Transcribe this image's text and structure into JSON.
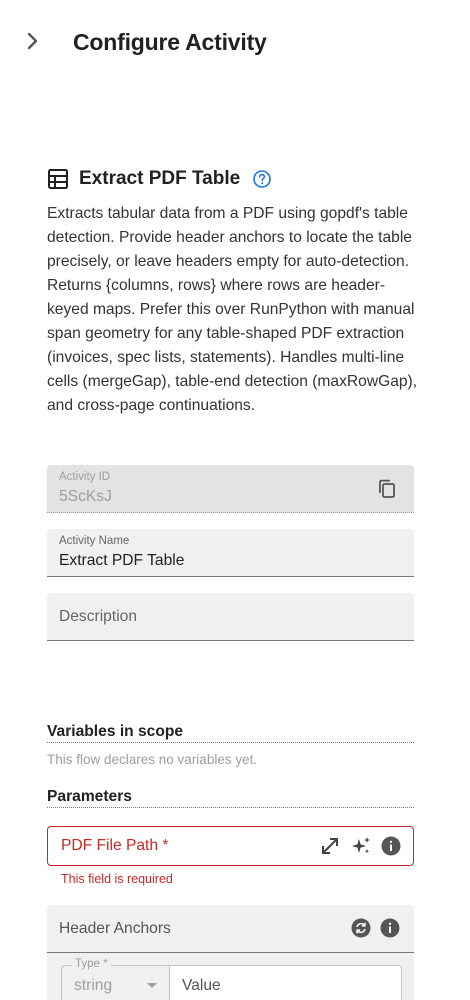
{
  "header": {
    "title": "Configure Activity"
  },
  "activity": {
    "title": "Extract PDF Table",
    "description": "Extracts tabular data from a PDF using gopdf's table detection. Provide header anchors to locate the table precisely, or leave headers empty for auto-detection. Returns {columns, rows} where rows are header-keyed maps. Prefer this over RunPython with manual span geometry for any table-shaped PDF extraction (invoices, spec lists, statements). Handles multi-line cells (mergeGap), table-end detection (maxRowGap), and cross-page continuations."
  },
  "fields": {
    "activity_id": {
      "label": "Activity ID",
      "value": "5ScKsJ"
    },
    "activity_name": {
      "label": "Activity Name",
      "value": "Extract PDF Table"
    },
    "description": {
      "placeholder": "Description"
    }
  },
  "variables": {
    "title": "Variables in scope",
    "empty_note": "This flow declares no variables yet."
  },
  "parameters": {
    "title": "Parameters",
    "pdf_file_path": {
      "label": "PDF File Path *",
      "error": "This field is required"
    },
    "header_anchors": {
      "title": "Header Anchors",
      "type_label": "Type *",
      "type_value": "string",
      "value_placeholder": "Value"
    }
  },
  "icons": {
    "collapse": "chevron-right-icon",
    "table": "table-icon",
    "help": "help-circle-icon",
    "copy": "copy-icon",
    "expand": "expand-diagonal-icon",
    "ai": "sparkles-icon",
    "info": "info-icon",
    "refresh": "refresh-icon"
  },
  "colors": {
    "accent": "#1a73e8",
    "error": "#c62828",
    "field_bg": "#f0f0f0"
  }
}
